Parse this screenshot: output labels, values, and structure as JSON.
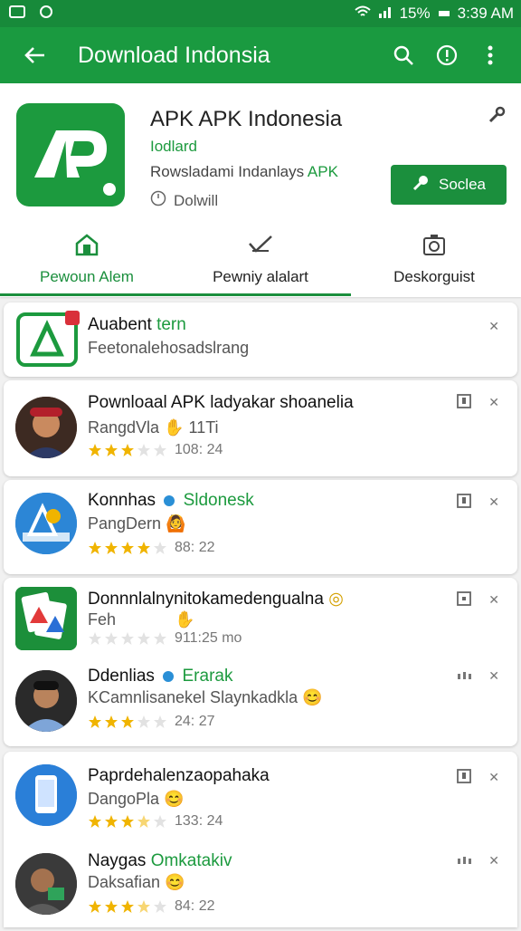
{
  "status": {
    "battery": "15%",
    "time": "3:39 AM"
  },
  "appbar": {
    "title": "Download Indonsia"
  },
  "app": {
    "name": "APK APK Indonesia",
    "developer": "Iodlard",
    "desc_prefix": "Rowsladami Indanlays",
    "desc_highlight": "APK",
    "size": "Dolwill",
    "install_label": "Soclea",
    "icon_letters": "AP"
  },
  "tabs": [
    {
      "label": "Pewoun Alem",
      "icon": "home-icon"
    },
    {
      "label": "Pewniy alalart",
      "icon": "check-icon"
    },
    {
      "label": "Deskorguist",
      "icon": "camera-icon"
    }
  ],
  "featured": {
    "title_a": "Auabent",
    "title_b": "tern",
    "sub": "Feetonalehosadslrang"
  },
  "list": [
    {
      "title": "Pownloaal APK ladyakar shoanelia",
      "sub": "RangdVla",
      "sub_extra": "11Ti",
      "rating": 3,
      "meta": "108: 24"
    },
    {
      "title": "Konnhas",
      "title_extra": "Sldonesk",
      "sub": "PangDern",
      "rating": 4,
      "meta": "88: 22"
    },
    {
      "title": "Donnnlalnynitokamedengualna",
      "sub": "Feh",
      "rating": 0,
      "meta": "911:25 mo"
    },
    {
      "title": "Ddenlias",
      "title_extra": "Erarak",
      "sub": "KCamnlisanekel Slaynkadkla",
      "rating": 3,
      "meta": "24: 27"
    },
    {
      "title": "Paprdehalenzaopahaka",
      "sub": "DangoPla",
      "rating": 3.5,
      "meta": "133: 24"
    },
    {
      "title": "Naygas",
      "title_extra": "Omkatakiv",
      "sub": "Daksafian",
      "rating": 3.5,
      "meta": "84: 22"
    }
  ],
  "colors": {
    "primary": "#1a9a40",
    "star": "#f0b400"
  }
}
